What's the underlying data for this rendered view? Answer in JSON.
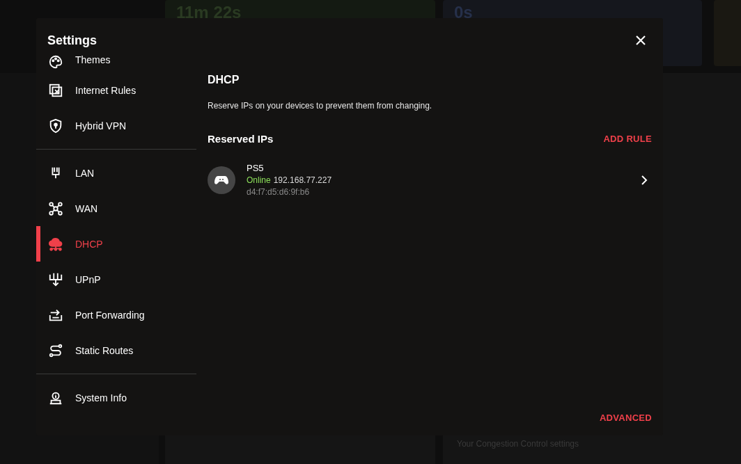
{
  "background": {
    "timer_a": "11m 22s",
    "timer_b": "0s",
    "caption": "Your Congestion Control settings"
  },
  "window": {
    "title": "Settings"
  },
  "sidebar": {
    "sections": [
      [
        {
          "label": "Themes",
          "selected": false
        },
        {
          "label": "Internet Rules",
          "selected": false
        },
        {
          "label": "Hybrid VPN",
          "selected": false
        }
      ],
      [
        {
          "label": "LAN",
          "selected": false
        },
        {
          "label": "WAN",
          "selected": false
        },
        {
          "label": "DHCP",
          "selected": true
        },
        {
          "label": "UPnP",
          "selected": false
        },
        {
          "label": "Port Forwarding",
          "selected": false
        },
        {
          "label": "Static Routes",
          "selected": false
        }
      ],
      [
        {
          "label": "System Info",
          "selected": false
        }
      ]
    ]
  },
  "content": {
    "title": "DHCP",
    "description": "Reserve IPs on your devices to prevent them from changing.",
    "section_title": "Reserved IPs",
    "add_button": "ADD RULE",
    "devices": [
      {
        "name": "PS5",
        "online": true,
        "status": "Online",
        "ip": "192.168.77.227",
        "mac": "d4:f7:d5:d6:9f:b6"
      }
    ],
    "advanced_button": "ADVANCED"
  }
}
